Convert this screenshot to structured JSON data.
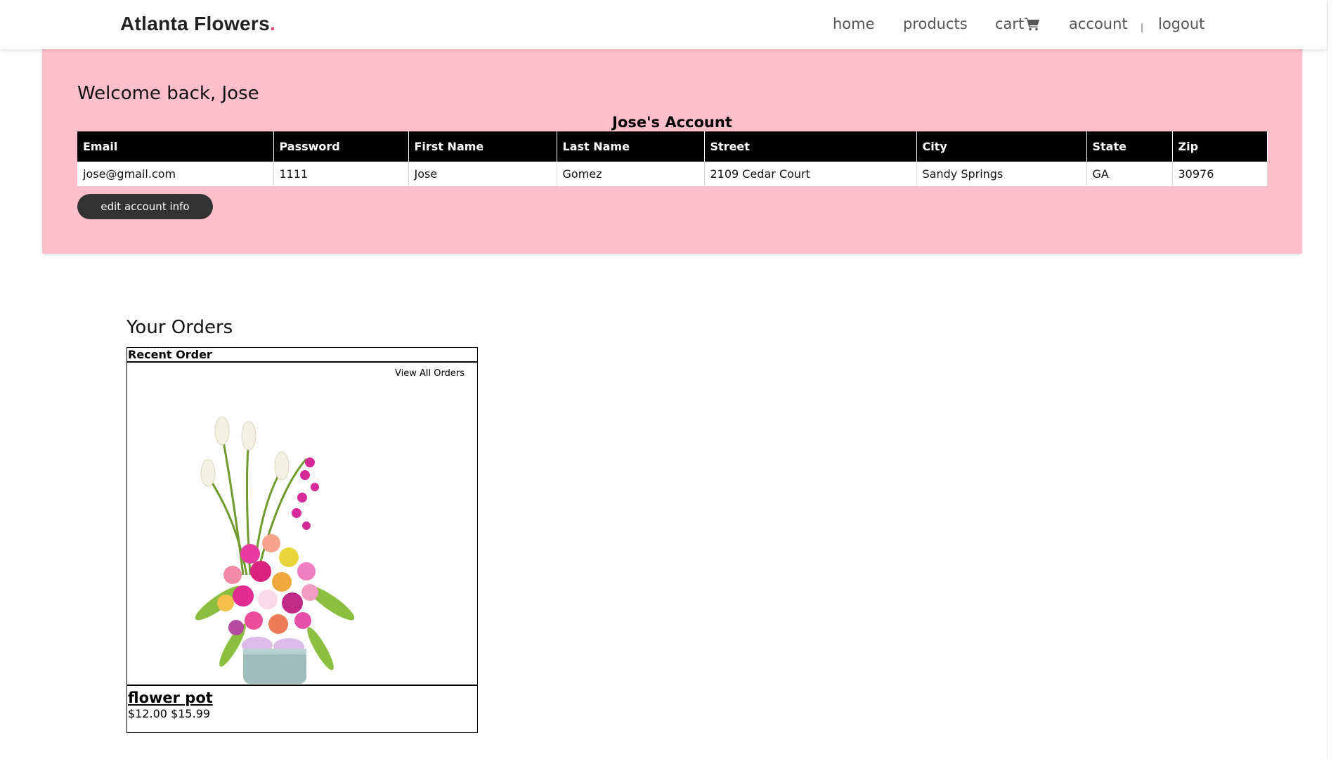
{
  "header": {
    "brand": "Atlanta Flowers",
    "brand_dot": ".",
    "nav": {
      "home": "home",
      "products": "products",
      "cart": "cart",
      "account": "account",
      "separator": "|",
      "logout": "logout"
    }
  },
  "account": {
    "welcome": "Welcome back, Jose",
    "title": "Jose's Account",
    "columns": [
      "Email",
      "Password",
      "First Name",
      "Last Name",
      "Street",
      "City",
      "State",
      "Zip"
    ],
    "row": [
      "jose@gmail.com",
      "1111",
      "Jose",
      "Gomez",
      "2109 Cedar Court",
      "Sandy Springs",
      "GA",
      "30976"
    ],
    "edit_button": "edit account info"
  },
  "orders": {
    "title": "Your Orders",
    "recent_label": "Recent Order",
    "view_all": "View All Orders",
    "product_name": "flower pot",
    "price": "$12.00 $15.99"
  },
  "colors": {
    "panel_bg": "#ffc0cb",
    "brand_dot": "#e0457b",
    "table_header_bg": "#000000",
    "button_bg": "#333333"
  },
  "icons": {
    "cart": "shopping-cart-icon",
    "product_image": "flower-vase-image"
  }
}
